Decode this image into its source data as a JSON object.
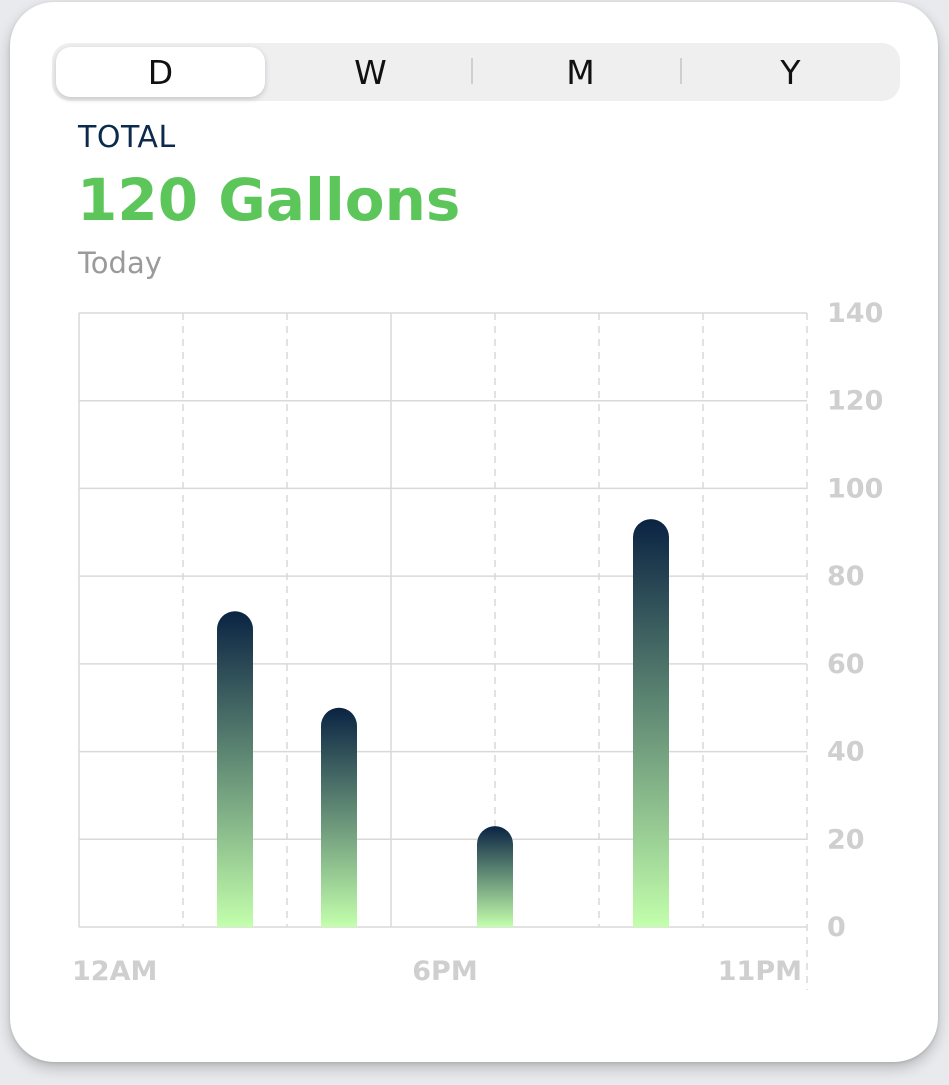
{
  "tabs": [
    {
      "label": "D",
      "active": true
    },
    {
      "label": "W",
      "active": false
    },
    {
      "label": "M",
      "active": false
    },
    {
      "label": "Y",
      "active": false
    }
  ],
  "summary": {
    "label": "TOTAL",
    "value": "120 Gallons",
    "period": "Today"
  },
  "colors": {
    "accent_green": "#5cc65a",
    "navy": "#0c2a4c",
    "bar_top": "#0a2343",
    "bar_bottom": "#c3ffac",
    "grid": "#d9d9d9",
    "tick": "#cfcfcf"
  },
  "chart_data": {
    "type": "bar",
    "title": "",
    "xlabel": "",
    "ylabel": "",
    "x_tick_labels": [
      "12AM",
      "6PM",
      "11PM"
    ],
    "y_ticks": [
      0,
      20,
      40,
      60,
      80,
      100,
      120,
      140
    ],
    "ylim": [
      0,
      140
    ],
    "grid": true,
    "y_axis_side": "right",
    "bars": [
      {
        "slot": 1,
        "value": 72
      },
      {
        "slot": 2,
        "value": 50
      },
      {
        "slot": 3.5,
        "value": 23
      },
      {
        "slot": 5,
        "value": 93
      }
    ]
  }
}
